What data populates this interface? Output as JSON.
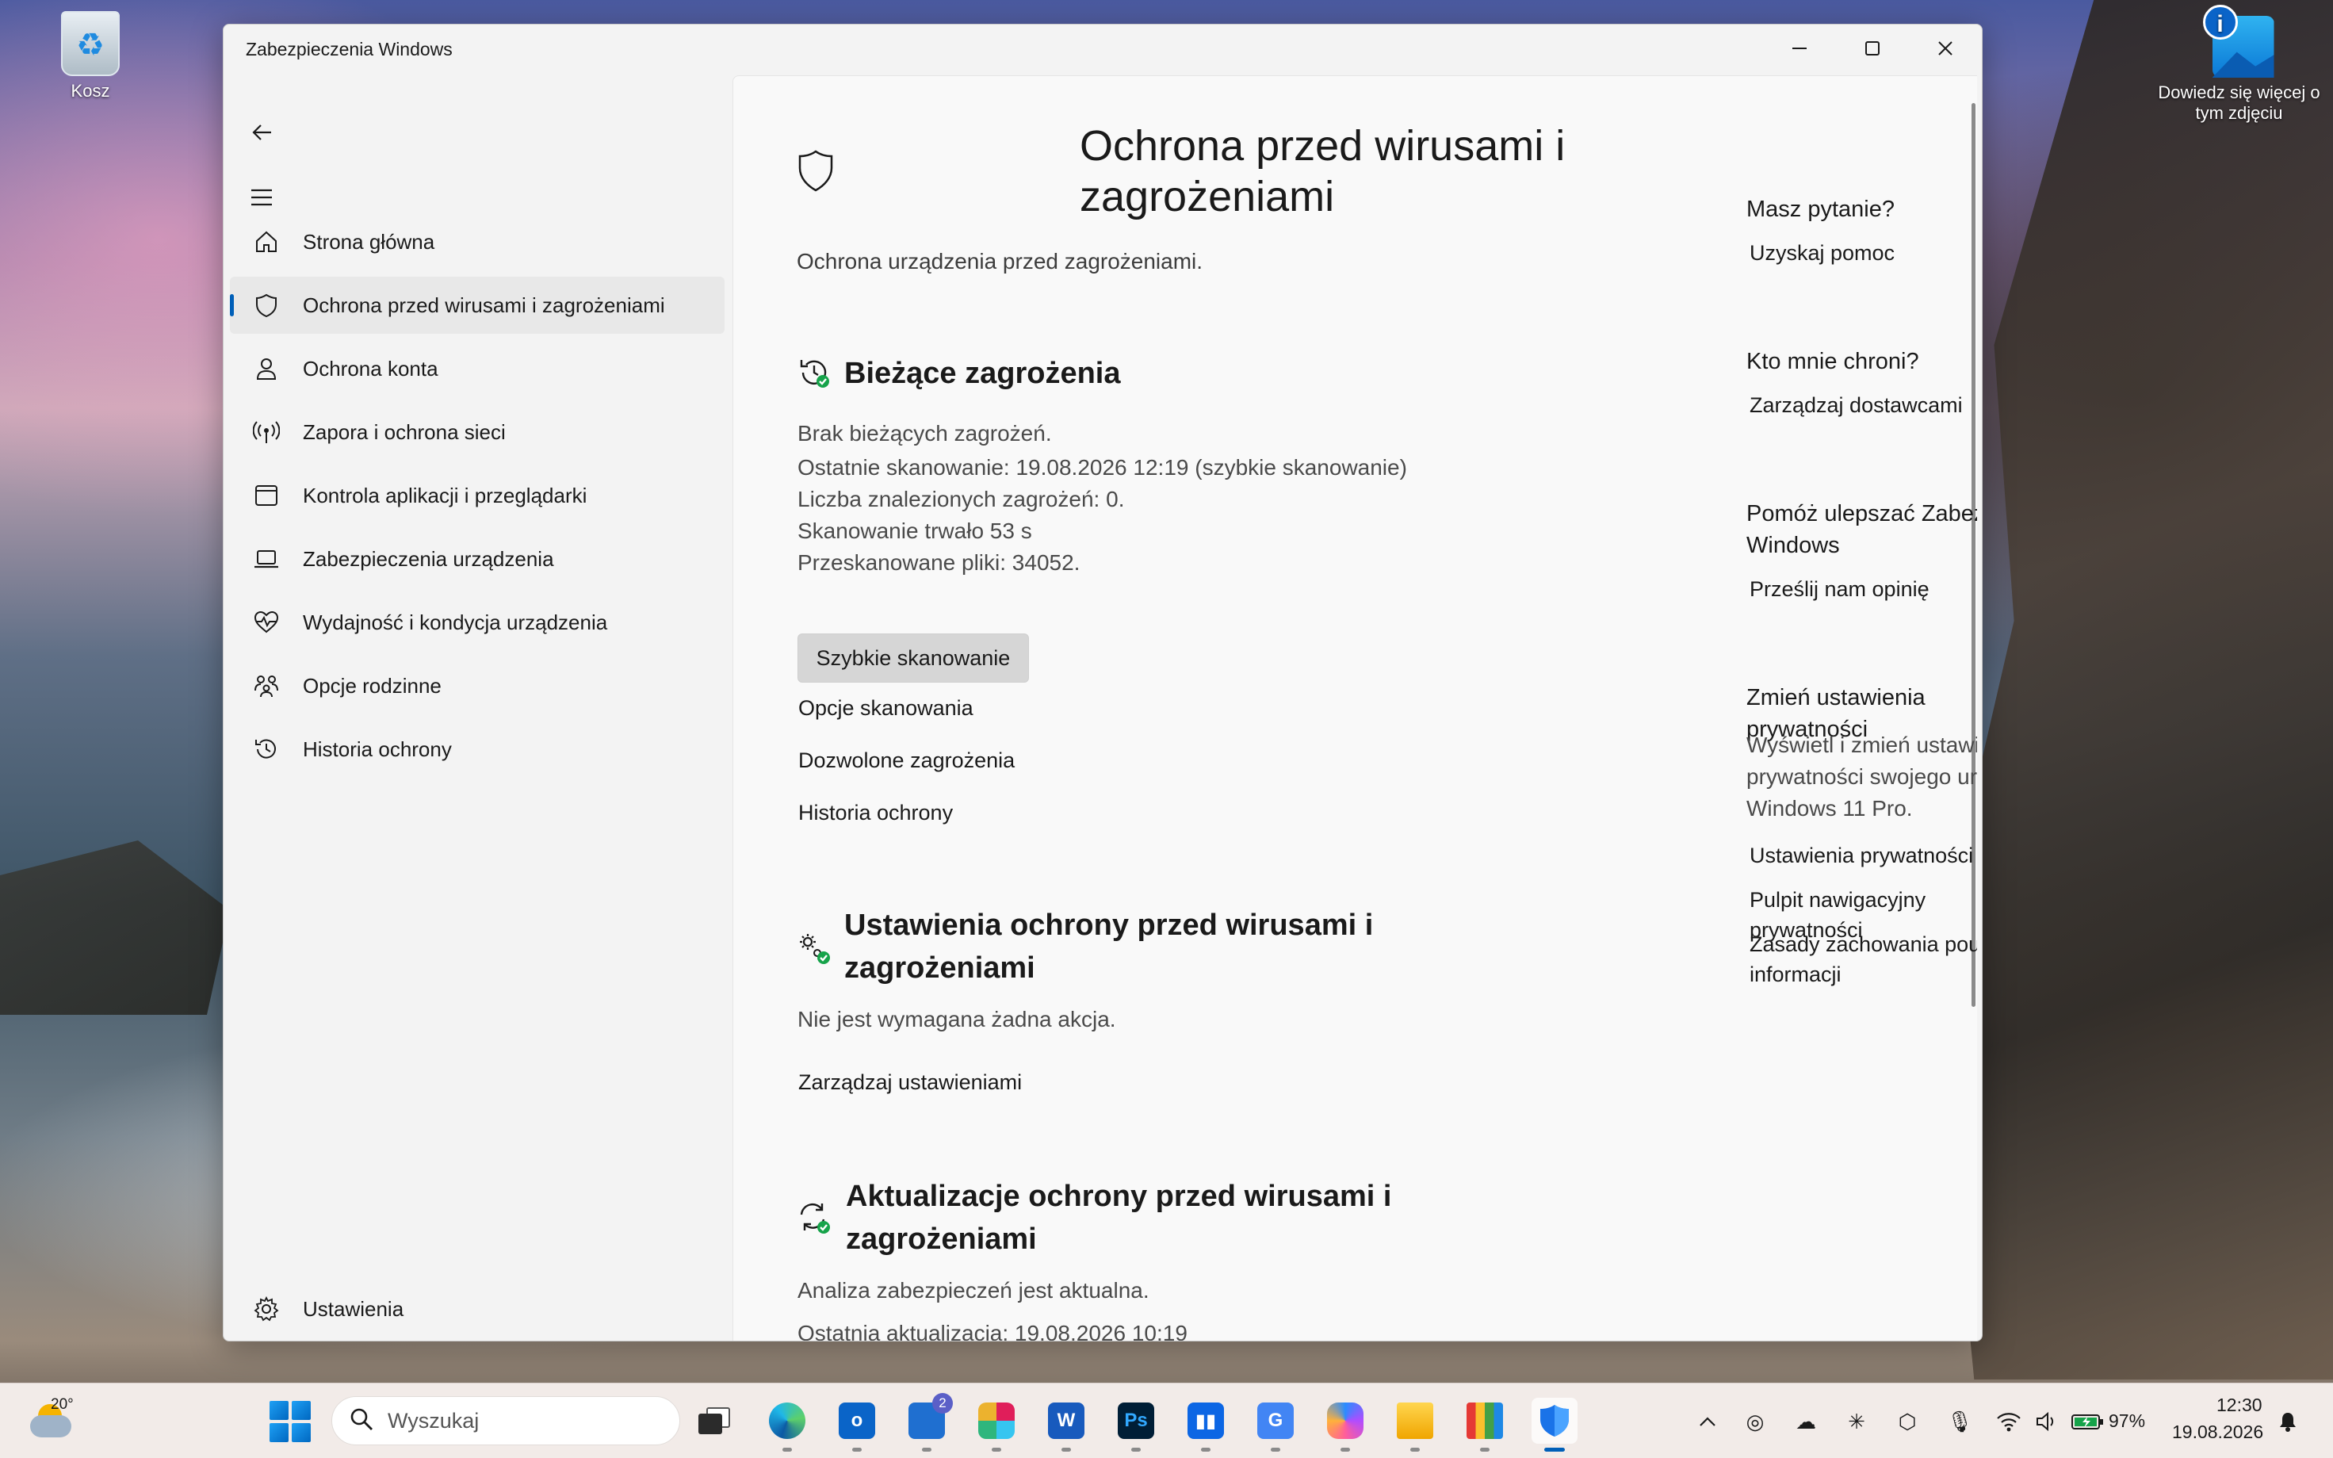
{
  "desktop": {
    "recycle_bin_label": "Kosz",
    "learn_more_label_line1": "Dowiedz się więcej o",
    "learn_more_label_line2": "tym zdjęciu"
  },
  "window": {
    "title": "Zabezpieczenia Windows",
    "minimize": "—",
    "maximize": "☐",
    "close": "✕"
  },
  "sidebar": {
    "items": [
      {
        "label": "Strona główna",
        "icon": "home-icon"
      },
      {
        "label": "Ochrona przed wirusami i zagrożeniami",
        "icon": "shield-icon",
        "active": true
      },
      {
        "label": "Ochrona konta",
        "icon": "person-icon"
      },
      {
        "label": "Zapora i ochrona sieci",
        "icon": "wireless-icon"
      },
      {
        "label": "Kontrola aplikacji i przeglądarki",
        "icon": "app-browser-icon"
      },
      {
        "label": "Zabezpieczenia urządzenia",
        "icon": "laptop-icon"
      },
      {
        "label": "Wydajność i kondycja urządzenia",
        "icon": "heart-pulse-icon"
      },
      {
        "label": "Opcje rodzinne",
        "icon": "family-icon"
      },
      {
        "label": "Historia ochrony",
        "icon": "history-icon"
      }
    ],
    "settings_label": "Ustawienia"
  },
  "main": {
    "title_line1": "Ochrona przed wirusami i",
    "title_line2": "zagrożeniami",
    "subtitle": "Ochrona urządzenia przed zagrożeniami.",
    "current_threats": {
      "heading": "Bieżące zagrożenia",
      "lines": [
        "Brak bieżących zagrożeń.",
        "Ostatnie skanowanie: 19.08.2026 12:19 (szybkie skanowanie)",
        "Liczba znalezionych zagrożeń: 0.",
        "Skanowanie trwało 53 s",
        "Przeskanowane pliki: 34052."
      ],
      "quick_scan_button": "Szybkie skanowanie",
      "links": [
        "Opcje skanowania",
        "Dozwolone zagrożenia",
        "Historia ochrony"
      ]
    },
    "settings_section": {
      "heading_line1": "Ustawienia ochrony przed wirusami i",
      "heading_line2": "zagrożeniami",
      "status": "Nie jest wymagana żadna akcja.",
      "link": "Zarządzaj ustawieniami"
    },
    "updates_section": {
      "heading_line1": "Aktualizacje ochrony przed wirusami i",
      "heading_line2": "zagrożeniami",
      "status": "Analiza zabezpieczeń jest aktualna.",
      "last_update": "Ostatnia aktualizacja: 19.08.2026 10:19"
    }
  },
  "right_panel": {
    "question_heading": "Masz pytanie?",
    "get_help_link": "Uzyskaj pomoc",
    "who_protects_heading": "Kto mnie chroni?",
    "manage_providers_link": "Zarządzaj dostawcami",
    "improve_heading_line1": "Pomóż ulepszać Zabezpieczenia",
    "improve_heading_line2": "Windows",
    "feedback_link": "Prześlij nam opinię",
    "privacy_heading": "Zmień ustawienia prywatności",
    "privacy_text_line1": "Wyświetl i zmień ustawienia",
    "privacy_text_line2": "prywatności swojego urządzenia",
    "privacy_text_line3": "Windows 11 Pro.",
    "privacy_settings_link": "Ustawienia prywatności",
    "privacy_dashboard_link": "Pulpit nawigacyjny prywatności",
    "privacy_statement_line1": "Zasady zachowania poufności",
    "privacy_statement_line2": "informacji"
  },
  "taskbar": {
    "weather_temp": "20°",
    "search_placeholder": "Wyszukaj",
    "teams_badge": "2",
    "battery_percent": "97%",
    "time": "12:30",
    "date": "19.08.2026"
  },
  "colors": {
    "accent": "#005fb8",
    "status_ok": "#16a34a"
  }
}
